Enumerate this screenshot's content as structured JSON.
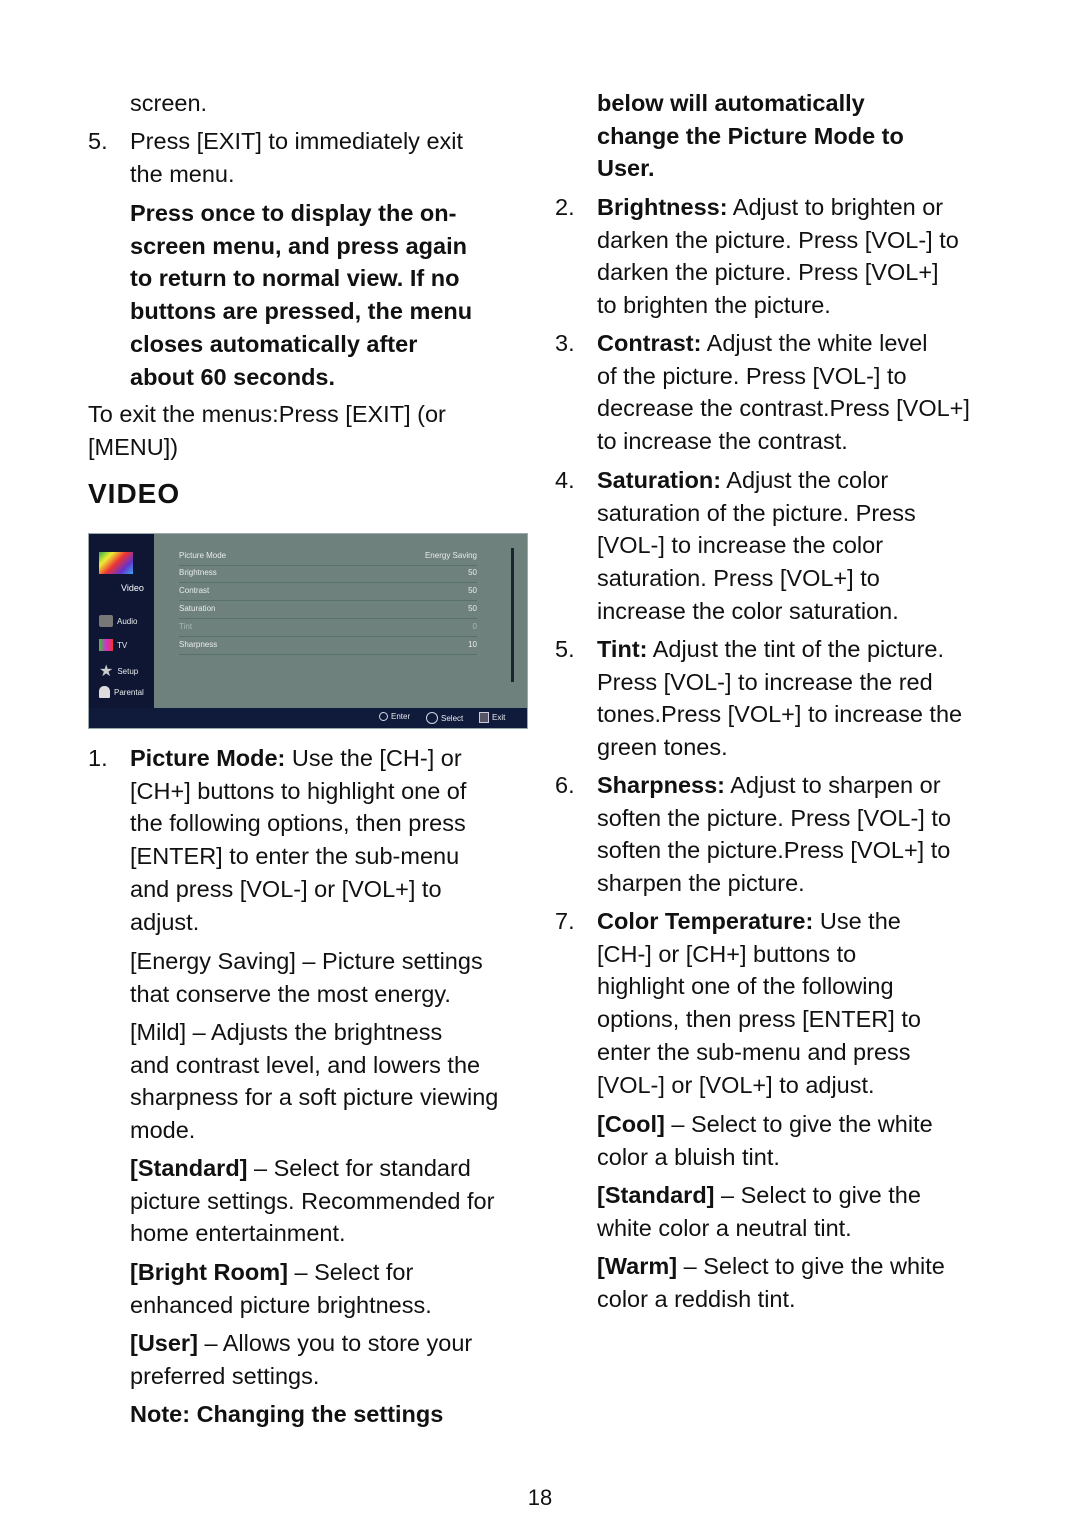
{
  "left": [
    {
      "runs": [
        {
          "t": "screen."
        }
      ]
    },
    {
      "num": "5.",
      "runs": [
        {
          "t": "Press [EXIT] to immediately exit\nthe menu."
        }
      ]
    },
    {
      "runs": [
        {
          "t": "Press once to display the on-\nscreen menu, and press again\nto return to normal view. If no\nbuttons are pressed, the menu\ncloses automatically after\nabout 60 seconds.",
          "b": true
        }
      ]
    },
    {
      "runs": [
        {
          "t": "To exit the menus:Press [EXIT] (or\n[MENU])"
        }
      ]
    },
    {
      "num": "1.",
      "runs": [
        {
          "t": "Picture Mode:",
          "b": true
        },
        {
          "t": " Use the [CH-] or\n[CH+] buttons to highlight one of\nthe following options, then press\n[ENTER] to enter the sub-menu\nand press [VOL-] or [VOL+] to\nadjust."
        }
      ]
    },
    {
      "runs": [
        {
          "t": "[Energy Saving]"
        },
        {
          "t": " – Picture settings\nthat conserve the most energy."
        }
      ]
    },
    {
      "runs": [
        {
          "t": "[Mild]"
        },
        {
          "t": " – Adjusts the brightness\nand contrast level, and lowers the\nsharpness for a soft picture viewing\nmode."
        }
      ]
    },
    {
      "runs": [
        {
          "t": "[Standard]",
          "b": true
        },
        {
          "t": " – Select for standard\npicture settings. Recommended for\nhome entertainment."
        }
      ]
    },
    {
      "runs": [
        {
          "t": "[Bright Room]",
          "b": true
        },
        {
          "t": " – Select for\nenhanced picture brightness."
        }
      ]
    },
    {
      "runs": [
        {
          "t": "[User]",
          "b": true
        },
        {
          "t": " – Allows you to store your\npreferred settings."
        }
      ]
    },
    {
      "runs": [
        {
          "t": "Note: Changing the settings",
          "b": true
        }
      ]
    }
  ],
  "right": [
    {
      "runs": [
        {
          "t": "below will automatically\nchange the Picture Mode to\nUser.",
          "b": true
        }
      ]
    },
    {
      "num": "2.",
      "runs": [
        {
          "t": "Brightness:",
          "b": true
        },
        {
          "t": " Adjust to brighten or\ndarken the picture. Press [VOL-] to\ndarken the picture. Press [VOL+]\nto brighten the picture."
        }
      ]
    },
    {
      "num": "3.",
      "runs": [
        {
          "t": "Contrast:",
          "b": true
        },
        {
          "t": " Adjust the white level\nof the picture. Press [VOL-] to\ndecrease the contrast.Press [VOL+]\nto increase the contrast."
        }
      ]
    },
    {
      "num": "4.",
      "runs": [
        {
          "t": "Saturation:",
          "b": true
        },
        {
          "t": " Adjust the color\nsaturation of the picture. Press\n[VOL-] to increase the color\nsaturation. Press [VOL+] to\nincrease the color saturation."
        }
      ]
    },
    {
      "num": "5.",
      "runs": [
        {
          "t": "Tint:",
          "b": true
        },
        {
          "t": " Adjust the tint of the picture.\nPress [VOL-] to increase the red\ntones.Press [VOL+] to increase the\ngreen tones."
        }
      ]
    },
    {
      "num": "6.",
      "runs": [
        {
          "t": "Sharpness:",
          "b": true
        },
        {
          "t": " Adjust to sharpen or\nsoften the picture. Press [VOL-] to\nsoften the picture.Press [VOL+] to\nsharpen the picture."
        }
      ]
    },
    {
      "num": "7.",
      "runs": [
        {
          "t": "Color Temperature:",
          "b": true
        },
        {
          "t": " Use the\n[CH-] or [CH+] buttons to\nhighlight one of the following\noptions, then press [ENTER] to\nenter the sub-menu and press\n[VOL-] or [VOL+] to adjust."
        }
      ]
    },
    {
      "runs": [
        {
          "t": "[Cool]",
          "b": true
        },
        {
          "t": " – Select to give the white\ncolor a bluish tint."
        }
      ]
    },
    {
      "runs": [
        {
          "t": "[Standard]",
          "b": true
        },
        {
          "t": " – Select to give the\nwhite color a neutral tint."
        }
      ]
    },
    {
      "runs": [
        {
          "t": "[Warm]",
          "b": true
        },
        {
          "t": " – Select to give the white\ncolor a reddish tint."
        }
      ]
    }
  ],
  "heading": "VIDEO",
  "page_number": "18",
  "tv_menu": {
    "sidebar": [
      {
        "label": "Video",
        "icon": "tv-rainbow-icon",
        "active": true
      },
      {
        "label": "Audio",
        "icon": "speaker-icon"
      },
      {
        "label": "TV",
        "icon": "tv-icon"
      },
      {
        "label": "Setup",
        "icon": "star-icon"
      },
      {
        "label": "Parental",
        "icon": "lock-icon"
      }
    ],
    "rows": [
      {
        "label": "Picture Mode",
        "value": "Energy Saving"
      },
      {
        "label": "Brightness",
        "value": "50"
      },
      {
        "label": "Contrast",
        "value": "50"
      },
      {
        "label": "Saturation",
        "value": "50"
      },
      {
        "label": "Tint",
        "value": "0",
        "disabled": true
      },
      {
        "label": "Sharpness",
        "value": "10"
      }
    ],
    "footer": {
      "enter": "Enter",
      "select": "Select",
      "exit": "Exit"
    },
    "colors": {
      "sidebar": "#0e1633",
      "panel": "#6f817d"
    }
  }
}
